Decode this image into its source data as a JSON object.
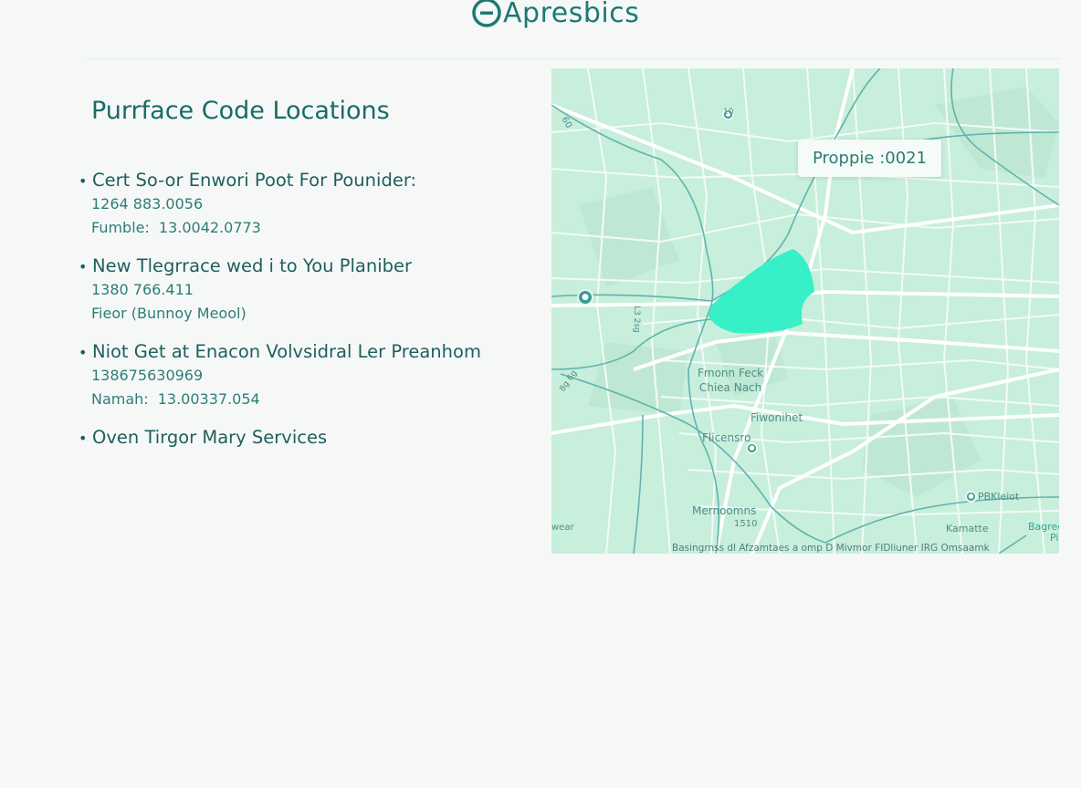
{
  "app": {
    "logo_text": "Apresbics",
    "logo_icon": "logo-circle-icon"
  },
  "main": {
    "title": "Purrface Code Locations",
    "locations": [
      {
        "name": "Cert So-or Enwori Poot For Pounider:",
        "lines": [
          {
            "label": "",
            "value": "1264 883.0056"
          },
          {
            "label": "Fumble:",
            "value": "13.0042.0773"
          }
        ]
      },
      {
        "name": "New Tlegrrace wed i to You Planiber",
        "lines": [
          {
            "label": "",
            "value": "1380 766.411"
          },
          {
            "label": "",
            "value": "Fieor (Bunnoy Meool)"
          }
        ]
      },
      {
        "name": "Niot Get at Enacon Volvsidral Ler Preanhom",
        "lines": [
          {
            "label": "",
            "value": "138675630969"
          },
          {
            "label": "Namah:",
            "value": "13.00337.054"
          }
        ]
      },
      {
        "name": "Oven Tirgor Mary Services",
        "lines": []
      }
    ]
  },
  "map": {
    "tooltip": "Proppie :0021",
    "highlight_color": "#38f0c8",
    "background_color": "#c8eedc",
    "road_color": "#ffffff",
    "river_color": "#5fb4ad",
    "labels": {
      "district_1_line1": "Fmonn Feck",
      "district_1_line2": "Chiea Nach",
      "district_2": "Fiwonihet",
      "district_3": "Flicensro",
      "district_4": "Mernoomns",
      "district_4_sub": "1510",
      "district_5": "PBKleiot",
      "district_6": "Kamatte",
      "district_7_line1": "Bagree",
      "district_7_line2": "Pi",
      "road_1": "60",
      "road_2": "10",
      "road_3": "L3 2sg",
      "road_4": "8g 6g",
      "west_label": "wear"
    },
    "footer": "Basingrnss dl Afzamtaes a omp D   Mivmor FIDliuner IRG Omsaamk"
  }
}
